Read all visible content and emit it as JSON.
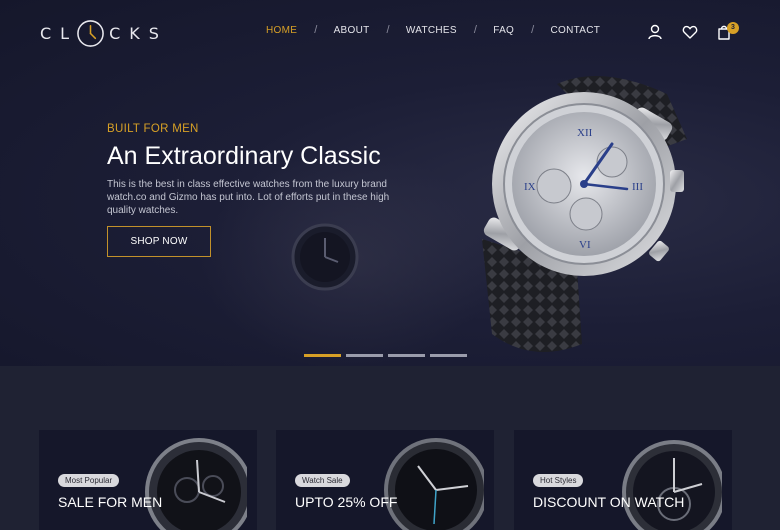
{
  "header": {
    "logo_left": "CL",
    "logo_right": "CKS",
    "nav": [
      "HOME",
      "ABOUT",
      "WATCHES",
      "FAQ",
      "CONTACT"
    ],
    "nav_active": "HOME",
    "icons": [
      "user-icon",
      "heart-icon",
      "cart-icon"
    ],
    "cart_count": "3"
  },
  "hero": {
    "eyebrow": "BUILT FOR MEN",
    "title": "An Extraordinary Classic",
    "description": "This is the best in class effective watches from the luxury brand watch.co and Gizmo has put into. Lot of efforts put in these high quality watches.",
    "button": "SHOP NOW",
    "slides": 4,
    "active_slide": 1
  },
  "cards": [
    {
      "badge": "Most Popular",
      "title": "SALE FOR MEN"
    },
    {
      "badge": "Watch Sale",
      "title": "UPTO 25% OFF"
    },
    {
      "badge": "Hot Styles",
      "title": "DISCOUNT ON WATCH"
    }
  ],
  "colors": {
    "accent": "#d7a026",
    "background": "#1f2233",
    "hero": "#1c1e36",
    "card": "#15172a"
  }
}
